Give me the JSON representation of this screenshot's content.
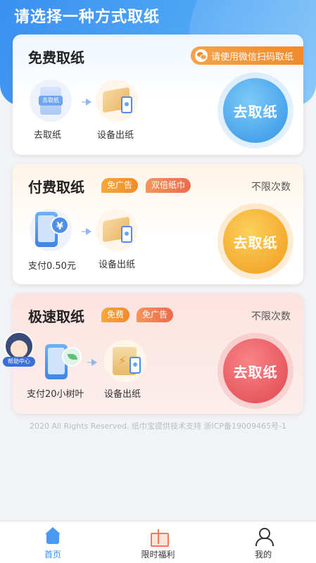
{
  "page": {
    "title": "请选择一种方式取纸"
  },
  "free": {
    "title": "免费取纸",
    "badge": "请使用微信扫码取纸",
    "steps": [
      {
        "label": "去取纸",
        "icon_label": "去取纸"
      },
      {
        "label": "设备出纸"
      }
    ],
    "button": "去取纸"
  },
  "paid": {
    "title": "付费取纸",
    "tags": [
      "免广告",
      "双倍纸巾"
    ],
    "limit": "不限次数",
    "steps": [
      {
        "label": "支付0.50元"
      },
      {
        "label": "设备出纸"
      }
    ],
    "coin_symbol": "¥",
    "button": "去取纸"
  },
  "fast": {
    "title": "极速取纸",
    "tags": [
      "免费",
      "免广告"
    ],
    "limit": "不限次数",
    "steps": [
      {
        "label": "支付20小树叶"
      },
      {
        "label": "设备出纸"
      }
    ],
    "button": "去取纸"
  },
  "helper": {
    "label": "帮助中心"
  },
  "footer": {
    "text": "2020 All Rights Reserved. 纸巾宝提供技术支持 浙ICP备19009465号-1"
  },
  "tabbar": {
    "items": [
      {
        "label": "首页",
        "icon": "home-icon",
        "active": true
      },
      {
        "label": "限时福利",
        "icon": "gift-icon",
        "active": false
      },
      {
        "label": "我的",
        "icon": "user-icon",
        "active": false
      }
    ]
  },
  "colors": {
    "accent_blue": "#3b8ff0",
    "orange": "#f29a1f",
    "red": "#e04751"
  }
}
